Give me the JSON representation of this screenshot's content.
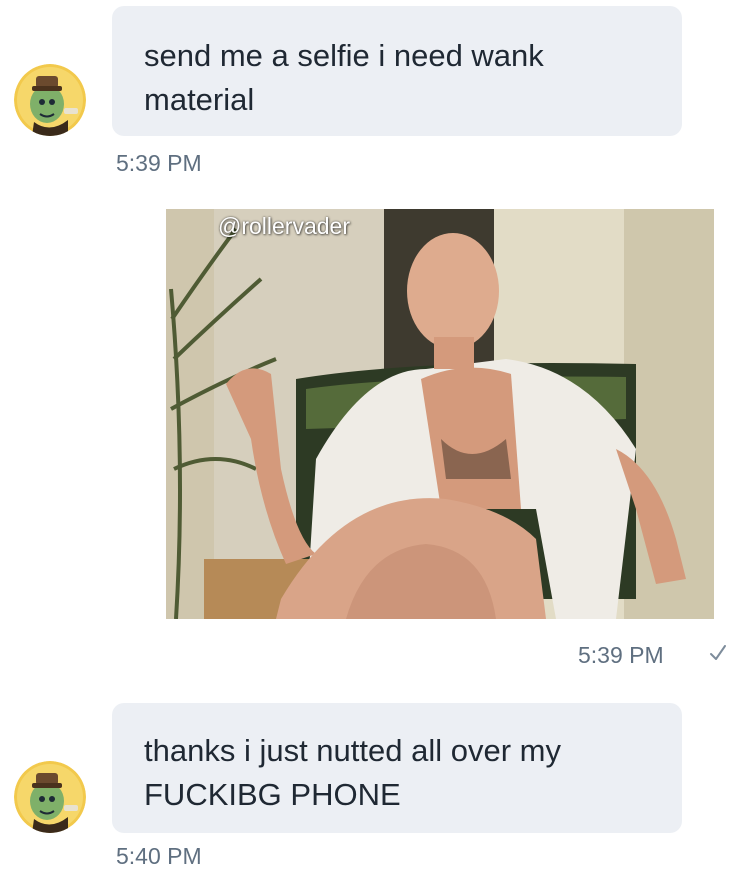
{
  "conversation": {
    "messages": [
      {
        "direction": "incoming",
        "lines": [
          "send me a selfie i need wank",
          "material"
        ],
        "time": "5:39 PM"
      },
      {
        "direction": "outgoing",
        "type": "image",
        "watermark": "@rollervader",
        "time": "5:39 PM",
        "status_icon": "checkmark-icon"
      },
      {
        "direction": "incoming",
        "lines": [
          "thanks i just nutted all over my",
          "FUCKIBG PHONE"
        ],
        "time": "5:40 PM"
      }
    ]
  },
  "colors": {
    "bubble_bg": "#eceff4",
    "timestamp": "#5f6f80",
    "text": "#1f2833"
  }
}
